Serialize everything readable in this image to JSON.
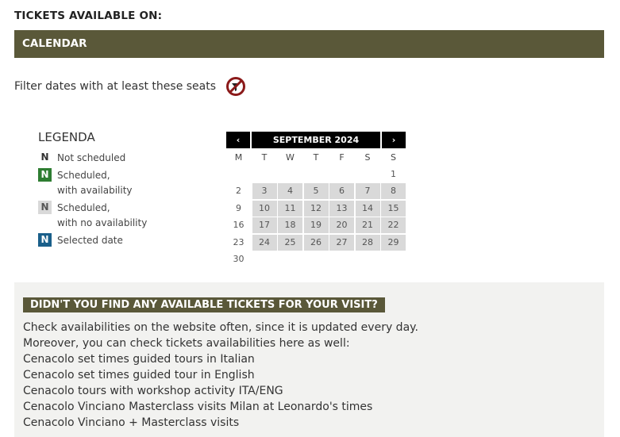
{
  "heading": "TICKETS AVAILABLE ON:",
  "calendar_header": "CALENDAR",
  "filter": {
    "label": "Filter dates with at least these seats"
  },
  "legend": {
    "title": "LEGENDA",
    "items": [
      {
        "box": "N",
        "line1": "Not scheduled",
        "line2": ""
      },
      {
        "box": "N",
        "line1": "Scheduled,",
        "line2": "with availability"
      },
      {
        "box": "N",
        "line1": "Scheduled,",
        "line2": "with no availability"
      },
      {
        "box": "N",
        "line1": "Selected date",
        "line2": ""
      }
    ]
  },
  "calendar": {
    "prev": "‹",
    "next": "›",
    "month": "SEPTEMBER 2024",
    "weekdays": [
      "M",
      "T",
      "W",
      "T",
      "F",
      "S",
      "S"
    ],
    "rows": [
      [
        "",
        "",
        "",
        "",
        "",
        "",
        "1"
      ],
      [
        "2",
        "3",
        "4",
        "5",
        "6",
        "7",
        "8"
      ],
      [
        "9",
        "10",
        "11",
        "12",
        "13",
        "14",
        "15"
      ],
      [
        "16",
        "17",
        "18",
        "19",
        "20",
        "21",
        "22"
      ],
      [
        "23",
        "24",
        "25",
        "26",
        "27",
        "28",
        "29"
      ],
      [
        "30",
        "",
        "",
        "",
        "",
        "",
        ""
      ]
    ]
  },
  "info": {
    "badge": "DIDN'T YOU FIND ANY AVAILABLE TICKETS FOR YOUR VISIT?",
    "line1": "Check availabilities on the website often, since it is updated every day.",
    "line2": "Moreover, you can check tickets availabilities here as well:",
    "links": [
      "Cenacolo set times guided tours in Italian",
      "Cenacolo set times guided tour in English",
      "Cenacolo tours with workshop activity ITA/ENG",
      "Cenacolo Vinciano Masterclass visits Milan at Leonardo's times",
      "Cenacolo Vinciano + Masterclass visits"
    ]
  }
}
